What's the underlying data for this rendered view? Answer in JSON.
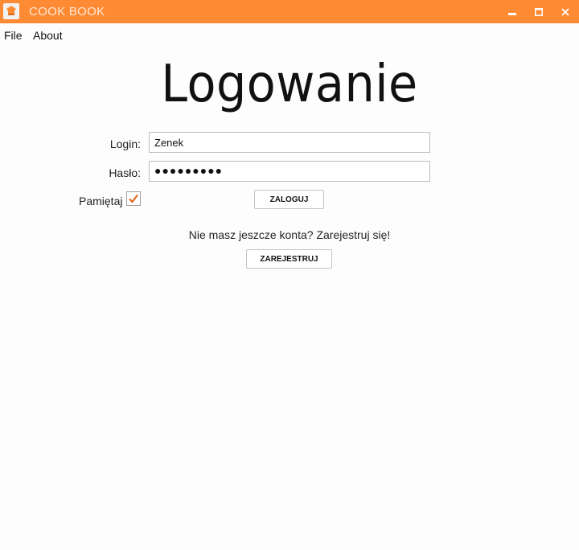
{
  "window": {
    "title": "COOK BOOK",
    "accent": "#ff8a34",
    "controls": [
      "minimize-icon",
      "maximize-icon",
      "close-icon"
    ]
  },
  "menu": {
    "file": "File",
    "about": "About"
  },
  "login_form": {
    "heading": "Logowanie",
    "login_label": "Login:",
    "login_value": "Zenek",
    "password_label": "Hasło:",
    "password_masked": "●●●●●●●●●",
    "remember_label": "Pamiętaj",
    "remember_checked": true,
    "login_button": "ZALOGUJ"
  },
  "register": {
    "prompt": "Nie masz jeszcze konta? Zarejestruj się!",
    "button": "ZAREJESTRUJ"
  }
}
